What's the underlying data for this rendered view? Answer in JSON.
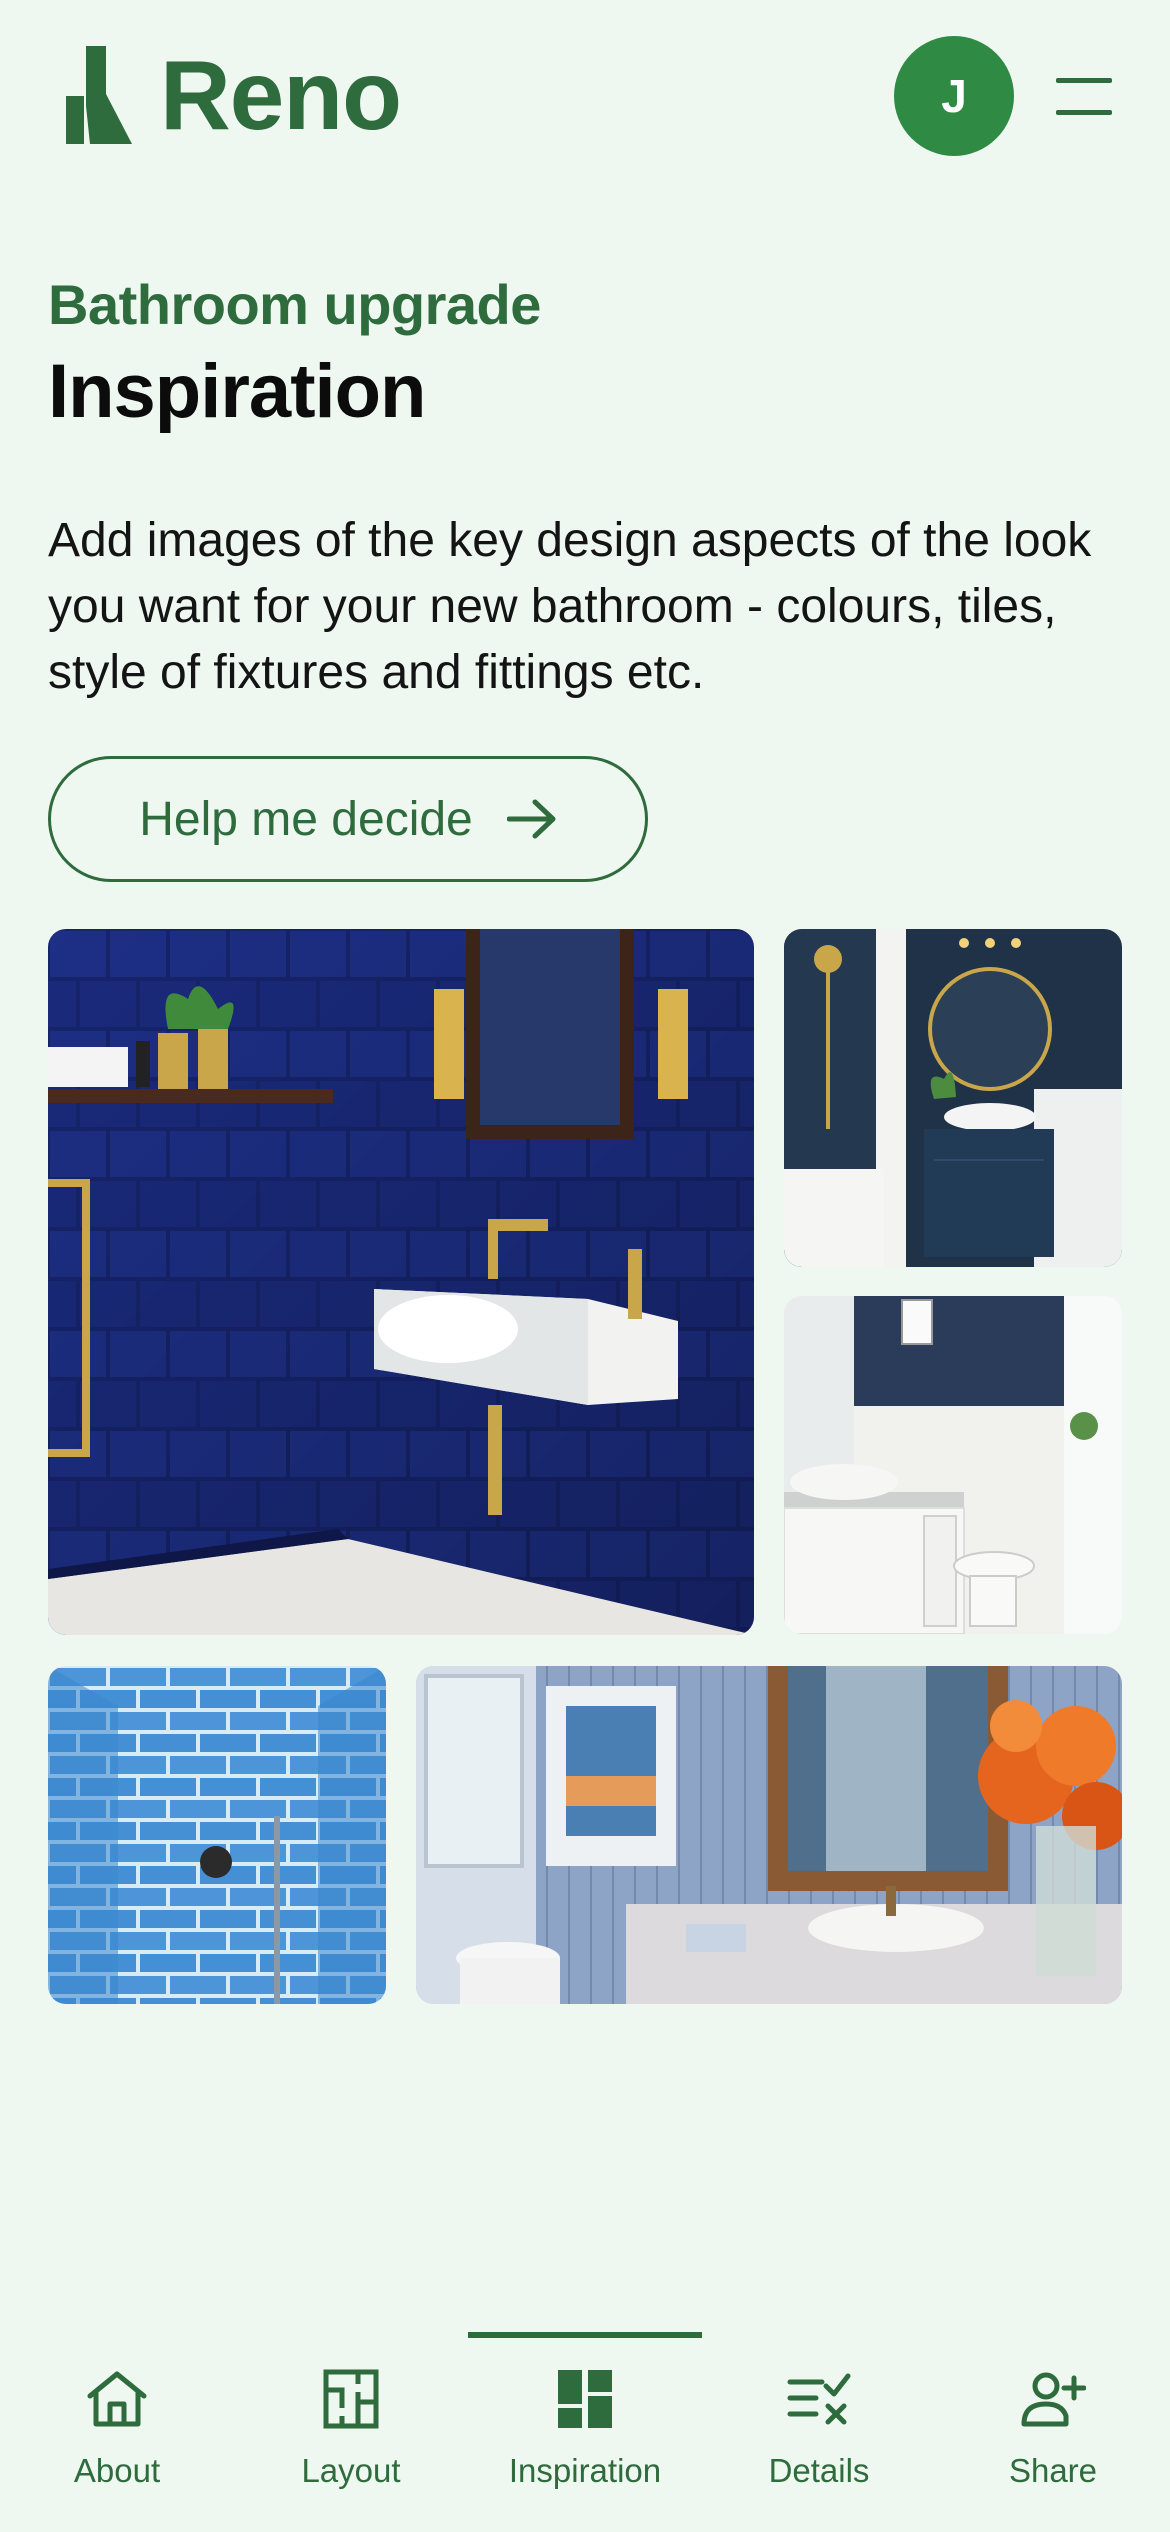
{
  "app": {
    "brand_name": "Reno",
    "avatar_initial": "J",
    "accent_color": "#2e6b3d",
    "background_color": "#eef7f0"
  },
  "page": {
    "eyebrow": "Bathroom upgrade",
    "title": "Inspiration",
    "description": "Add images of the key design aspects of the look you want for your new bathroom - colours, tiles, style of fixtures and fittings etc.",
    "help_button_label": "Help me decide"
  },
  "gallery": [
    {
      "icon": "navy-subway-tile-bathroom-photo"
    },
    {
      "icon": "navy-bathroom-gold-mirror-photo"
    },
    {
      "icon": "white-vanity-navy-wall-photo"
    },
    {
      "icon": "light-blue-tiled-shower-photo"
    },
    {
      "icon": "blue-panelled-bathroom-orange-flowers-photo"
    }
  ],
  "nav": {
    "items": [
      {
        "label": "About",
        "icon": "home-icon"
      },
      {
        "label": "Layout",
        "icon": "floorplan-icon"
      },
      {
        "label": "Inspiration",
        "icon": "grid-layout-icon",
        "active": true
      },
      {
        "label": "Details",
        "icon": "checklist-icon"
      },
      {
        "label": "Share",
        "icon": "add-person-icon"
      }
    ]
  }
}
